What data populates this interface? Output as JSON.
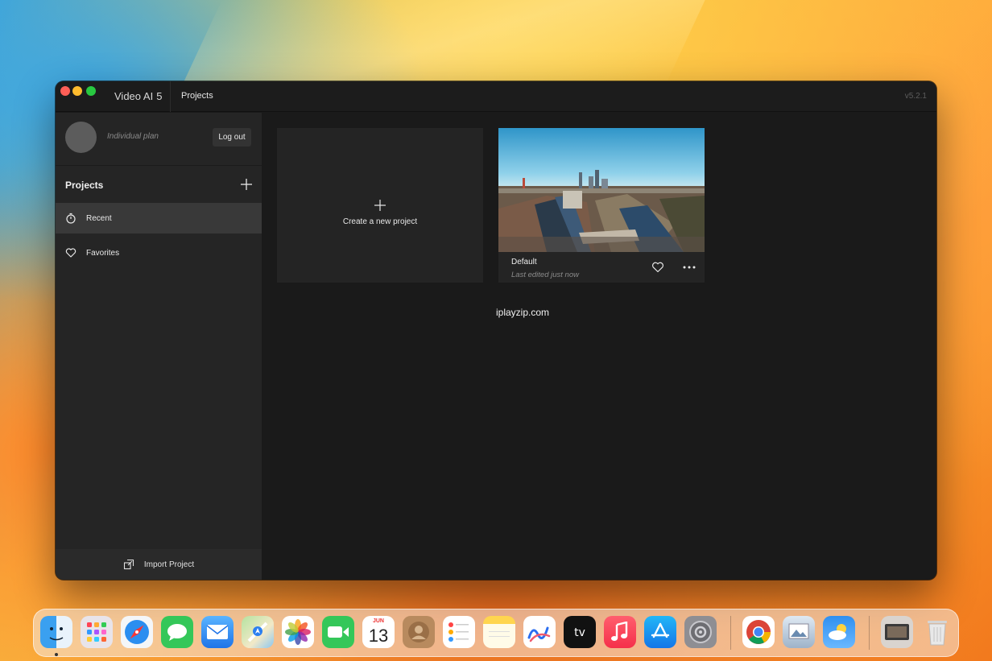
{
  "window": {
    "app_name": "Video AI",
    "app_version_major": "5",
    "nav_projects": "Projects",
    "version": "v5.2.1"
  },
  "sidebar": {
    "plan": "Individual plan",
    "logout_label": "Log out",
    "projects_heading": "Projects",
    "items": [
      {
        "label": "Recent",
        "icon": "stopwatch-icon",
        "active": true
      },
      {
        "label": "Favorites",
        "icon": "heart-icon",
        "active": false
      }
    ],
    "import_label": "Import Project"
  },
  "main": {
    "new_project_label": "Create a new project",
    "project": {
      "title": "Default",
      "subtitle": "Last edited just now"
    },
    "watermark": "iplayzip.com"
  },
  "dock": {
    "calendar_month": "JUN",
    "calendar_day": "13",
    "apps": [
      "finder",
      "launchpad",
      "safari",
      "messages",
      "mail",
      "maps",
      "photos",
      "facetime",
      "calendar",
      "contacts",
      "reminders",
      "notes",
      "freeform",
      "apple-tv",
      "music",
      "app-store",
      "system-settings",
      "chrome",
      "preview",
      "weather",
      "topaz-video-ai",
      "trash"
    ]
  },
  "colors": {
    "window_bg": "#1a1a1a",
    "sidebar_bg": "#252525",
    "active_item_bg": "#393939",
    "card_bg": "#242424"
  }
}
